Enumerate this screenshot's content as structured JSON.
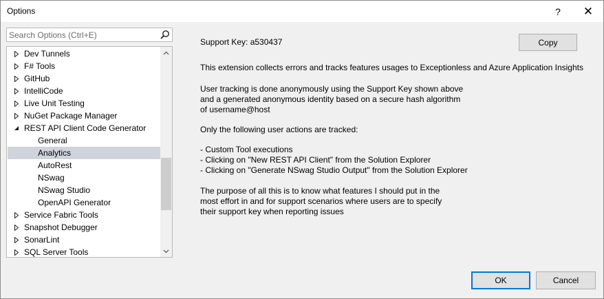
{
  "window": {
    "title": "Options",
    "help_label": "?",
    "close_label": "✕"
  },
  "search": {
    "placeholder": "Search Options (Ctrl+E)"
  },
  "tree": {
    "items": [
      {
        "label": "Dev Tunnels",
        "expander": "collapsed",
        "level": 0
      },
      {
        "label": "F# Tools",
        "expander": "collapsed",
        "level": 0
      },
      {
        "label": "GitHub",
        "expander": "collapsed",
        "level": 0
      },
      {
        "label": "IntelliCode",
        "expander": "collapsed",
        "level": 0
      },
      {
        "label": "Live Unit Testing",
        "expander": "collapsed",
        "level": 0
      },
      {
        "label": "NuGet Package Manager",
        "expander": "collapsed",
        "level": 0
      },
      {
        "label": "REST API Client Code Generator",
        "expander": "expanded",
        "level": 0
      },
      {
        "label": "General",
        "expander": "none",
        "level": 1
      },
      {
        "label": "Analytics",
        "expander": "none",
        "level": 1,
        "selected": true
      },
      {
        "label": "AutoRest",
        "expander": "none",
        "level": 1
      },
      {
        "label": "NSwag",
        "expander": "none",
        "level": 1
      },
      {
        "label": "NSwag Studio",
        "expander": "none",
        "level": 1
      },
      {
        "label": "OpenAPI Generator",
        "expander": "none",
        "level": 1
      },
      {
        "label": "Service Fabric Tools",
        "expander": "collapsed",
        "level": 0
      },
      {
        "label": "Snapshot Debugger",
        "expander": "collapsed",
        "level": 0
      },
      {
        "label": "SonarLint",
        "expander": "collapsed",
        "level": 0
      },
      {
        "label": "SQL Server Tools",
        "expander": "collapsed",
        "level": 0
      }
    ]
  },
  "content": {
    "support_key": "Support Key: a530437",
    "copy_label": "Copy",
    "intro": "This extension collects errors and tracks features usages to Exceptionless and Azure Application Insights",
    "tracking_1": "User tracking is done anonymously using the Support Key shown above",
    "tracking_2": "and a generated anonymous identity based on a secure hash algorithm",
    "tracking_3": "of username@host",
    "actions_header": "Only the following user actions are tracked:",
    "action_1": "- Custom Tool executions",
    "action_2": "- Clicking on \"New REST API Client\" from the Solution Explorer",
    "action_3": "- Clicking on \"Generate NSwag Studio Output\" from the Solution Explorer",
    "purpose_1": "The purpose of all this is to know what features I should put in the",
    "purpose_2": "most effort in and for support scenarios where users are to specify",
    "purpose_3": "their support key when reporting issues"
  },
  "footer": {
    "ok_label": "OK",
    "cancel_label": "Cancel"
  },
  "colors": {
    "accent": "#0078d7",
    "selection": "#cfd4dc"
  }
}
